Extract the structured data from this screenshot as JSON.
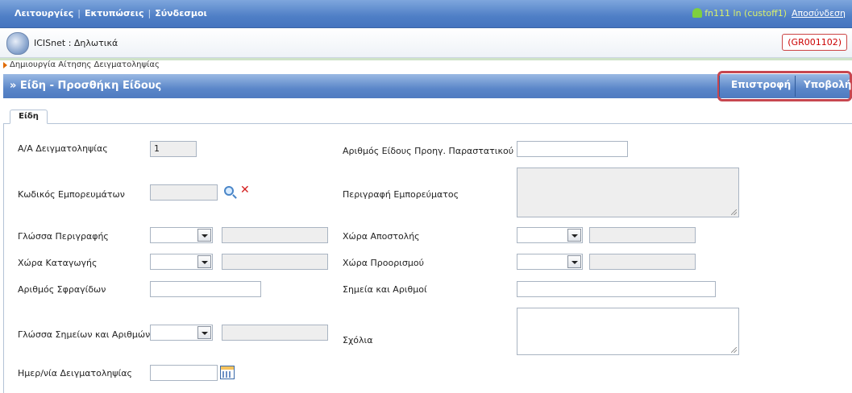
{
  "menu": {
    "items": [
      "Λειτουργίες",
      "Εκτυπώσεις",
      "Σύνδεσμοι"
    ],
    "user": "fn111 ln (custoff1)",
    "logout": "Αποσύνδεση"
  },
  "app": {
    "title": "ICISnet : Δηλωτικά",
    "code": "(GR001102)"
  },
  "breadcrumb": "Δημιουργία Αίτησης Δειγματοληψίας",
  "section": {
    "title": "» Είδη - Προσθήκη Είδους",
    "back_label": "Επιστροφή",
    "submit_label": "Υποβολή"
  },
  "tabs": [
    "Είδη"
  ],
  "form": {
    "sample_seq_label": "Α/Α Δειγματοληψίας",
    "sample_seq_value": "1",
    "prev_doc_item_label": "Αριθμός Είδους Προηγ. Παραστατικού",
    "prev_doc_item_value": "",
    "goods_code_label": "Κωδικός Εμπορευμάτων",
    "goods_code_value": "",
    "goods_desc_label": "Περιγραφή Εμπορεύματος",
    "goods_desc_value": "",
    "desc_lang_label": "Γλώσσα Περιγραφής",
    "dispatch_country_label": "Χώρα Αποστολής",
    "origin_country_label": "Χώρα Καταγωγής",
    "dest_country_label": "Χώρα Προορισμού",
    "seals_count_label": "Αριθμός Σφραγίδων",
    "seals_count_value": "",
    "marks_numbers_label": "Σημεία και Αριθμοί",
    "marks_numbers_value": "",
    "marks_lang_label": "Γλώσσα Σημείων και Αριθμών",
    "comments_label": "Σχόλια",
    "comments_value": "",
    "sample_date_label": "Ημερ/νία Δειγματοληψίας",
    "sample_date_value": ""
  }
}
